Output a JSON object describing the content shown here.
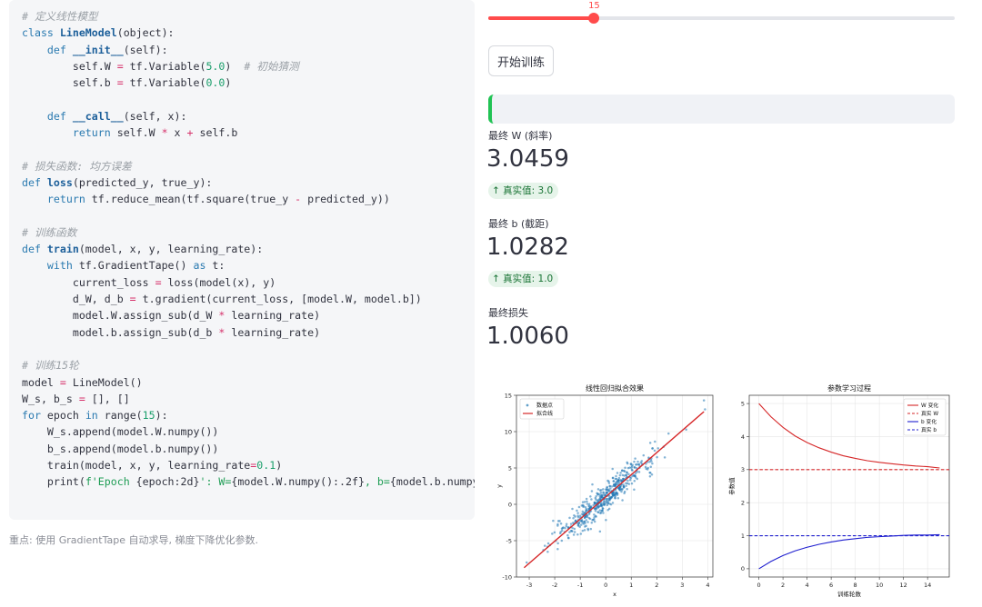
{
  "code": {
    "lines": [
      [
        [
          "cm",
          "# 定义线性模型"
        ]
      ],
      [
        [
          "kw",
          "class "
        ],
        [
          "fn",
          "LineModel"
        ],
        [
          "t",
          "(object):"
        ]
      ],
      [
        [
          "t",
          "    "
        ],
        [
          "kw",
          "def "
        ],
        [
          "fn",
          "__init__"
        ],
        [
          "t",
          "(self):"
        ]
      ],
      [
        [
          "t",
          "        self.W "
        ],
        [
          "op",
          "="
        ],
        [
          "t",
          " tf.Variable("
        ],
        [
          "num",
          "5.0"
        ],
        [
          "t",
          ")  "
        ],
        [
          "cm",
          "# 初始猜测"
        ]
      ],
      [
        [
          "t",
          "        self.b "
        ],
        [
          "op",
          "="
        ],
        [
          "t",
          " tf.Variable("
        ],
        [
          "num",
          "0.0"
        ],
        [
          "t",
          ")"
        ]
      ],
      [],
      [
        [
          "t",
          "    "
        ],
        [
          "kw",
          "def "
        ],
        [
          "fn",
          "__call__"
        ],
        [
          "t",
          "(self, x):"
        ]
      ],
      [
        [
          "t",
          "        "
        ],
        [
          "kw",
          "return"
        ],
        [
          "t",
          " self.W "
        ],
        [
          "op",
          "*"
        ],
        [
          "t",
          " x "
        ],
        [
          "op",
          "+"
        ],
        [
          "t",
          " self.b"
        ]
      ],
      [],
      [
        [
          "cm",
          "# 损失函数: 均方误差"
        ]
      ],
      [
        [
          "kw",
          "def "
        ],
        [
          "fn",
          "loss"
        ],
        [
          "t",
          "(predicted_y, true_y):"
        ]
      ],
      [
        [
          "t",
          "    "
        ],
        [
          "kw",
          "return"
        ],
        [
          "t",
          " tf.reduce_mean(tf.square(true_y "
        ],
        [
          "op",
          "-"
        ],
        [
          "t",
          " predicted_y))"
        ]
      ],
      [],
      [
        [
          "cm",
          "# 训练函数"
        ]
      ],
      [
        [
          "kw",
          "def "
        ],
        [
          "fn",
          "train"
        ],
        [
          "t",
          "(model, x, y, learning_rate):"
        ]
      ],
      [
        [
          "t",
          "    "
        ],
        [
          "kw",
          "with"
        ],
        [
          "t",
          " tf.GradientTape() "
        ],
        [
          "kw",
          "as"
        ],
        [
          "t",
          " t:"
        ]
      ],
      [
        [
          "t",
          "        current_loss "
        ],
        [
          "op",
          "="
        ],
        [
          "t",
          " loss(model(x), y)"
        ]
      ],
      [
        [
          "t",
          "        d_W, d_b "
        ],
        [
          "op",
          "="
        ],
        [
          "t",
          " t.gradient(current_loss, [model.W, model.b])"
        ]
      ],
      [
        [
          "t",
          "        model.W.assign_sub(d_W "
        ],
        [
          "op",
          "*"
        ],
        [
          "t",
          " learning_rate)"
        ]
      ],
      [
        [
          "t",
          "        model.b.assign_sub(d_b "
        ],
        [
          "op",
          "*"
        ],
        [
          "t",
          " learning_rate)"
        ]
      ],
      [],
      [
        [
          "cm",
          "# 训练15轮"
        ]
      ],
      [
        [
          "t",
          "model "
        ],
        [
          "op",
          "="
        ],
        [
          "t",
          " LineModel()"
        ]
      ],
      [
        [
          "t",
          "W_s, b_s "
        ],
        [
          "op",
          "="
        ],
        [
          "t",
          " [], []"
        ]
      ],
      [
        [
          "kw",
          "for"
        ],
        [
          "t",
          " epoch "
        ],
        [
          "kw",
          "in"
        ],
        [
          "t",
          " range("
        ],
        [
          "num",
          "15"
        ],
        [
          "t",
          "):"
        ]
      ],
      [
        [
          "t",
          "    W_s.append(model.W.numpy())"
        ]
      ],
      [
        [
          "t",
          "    b_s.append(model.b.numpy())"
        ]
      ],
      [
        [
          "t",
          "    train(model, x, y, learning_rate"
        ],
        [
          "op",
          "="
        ],
        [
          "num",
          "0.1"
        ],
        [
          "t",
          ")"
        ]
      ],
      [
        [
          "t",
          "    print("
        ],
        [
          "str",
          "f'Epoch "
        ],
        [
          "t",
          "{epoch:2d}"
        ],
        [
          "str",
          "': W="
        ],
        [
          "t",
          "{model.W.numpy():.2f}"
        ],
        [
          "str",
          ", b="
        ],
        [
          "t",
          "{model.b.numpy()"
        ]
      ]
    ]
  },
  "caption": "重点: 使用 GradientTape 自动求导, 梯度下降优化参数.",
  "slider": {
    "value": 15,
    "value_label": "15",
    "fraction": 0.227
  },
  "train_button_label": "开始训练",
  "metrics": [
    {
      "label": "最终 W (斜率)",
      "value": "3.0459",
      "delta": "真实值: 3.0"
    },
    {
      "label": "最终 b (截距)",
      "value": "1.0282",
      "delta": "真实值: 1.0"
    },
    {
      "label": "最终损失",
      "value": "1.0060",
      "delta": ""
    }
  ],
  "delta_arrow": "↑",
  "colors": {
    "accent": "#ff4b4b",
    "success": "#21c354",
    "scatter": "#1f77b4",
    "fit_line": "#d62728",
    "w_line": "#d62728",
    "b_line": "#1f1fcf"
  },
  "chart_data": [
    {
      "type": "scatter",
      "title": "线性回归拟合效果",
      "xlabel": "x",
      "ylabel": "y",
      "xlim": [
        -3.5,
        4.2
      ],
      "ylim": [
        -10,
        15
      ],
      "x_ticks": [
        -3,
        -2,
        -1,
        0,
        1,
        2,
        3,
        4
      ],
      "y_ticks": [
        -10,
        -5,
        0,
        5,
        10,
        15
      ],
      "grid": true,
      "legend": "top-left",
      "series": [
        {
          "name": "数据点",
          "kind": "scatter",
          "n_points": 500,
          "slope": 3.0,
          "intercept": 1.0,
          "noise_sd": 1.0,
          "x_sd": 1.0,
          "outliers": [
            [
              3.85,
              14.3
            ],
            [
              -3.1,
              -8.0
            ]
          ]
        },
        {
          "name": "拟合线",
          "kind": "line",
          "x": [
            -3.2,
            3.85
          ],
          "y": [
            -8.72,
            12.75
          ]
        }
      ]
    },
    {
      "type": "line",
      "title": "参数学习过程",
      "xlabel": "训练轮数",
      "ylabel": "参数值",
      "xlim": [
        -0.8,
        15.8
      ],
      "ylim": [
        -0.25,
        5.25
      ],
      "x_ticks": [
        0,
        2,
        4,
        6,
        8,
        10,
        12,
        14
      ],
      "y_ticks": [
        0,
        1,
        2,
        3,
        4,
        5
      ],
      "grid": true,
      "legend": "top-right",
      "x": [
        0,
        1,
        2,
        3,
        4,
        5,
        6,
        7,
        8,
        9,
        10,
        11,
        12,
        13,
        14,
        15
      ],
      "series": [
        {
          "name": "W 变化",
          "style": "solid",
          "color": "#d62728",
          "values": [
            5.0,
            4.6,
            4.28,
            4.02,
            3.82,
            3.66,
            3.53,
            3.42,
            3.34,
            3.27,
            3.22,
            3.18,
            3.14,
            3.11,
            3.09,
            3.05
          ]
        },
        {
          "name": "真实 W",
          "style": "dashed",
          "color": "#d62728",
          "values": [
            3.0,
            3.0
          ],
          "x": [
            -0.8,
            15.8
          ]
        },
        {
          "name": "b 变化",
          "style": "solid",
          "color": "#1f1fcf",
          "values": [
            0.0,
            0.22,
            0.4,
            0.54,
            0.65,
            0.74,
            0.81,
            0.87,
            0.91,
            0.95,
            0.97,
            0.99,
            1.01,
            1.02,
            1.02,
            1.03
          ]
        },
        {
          "name": "真实 b",
          "style": "dashed",
          "color": "#1f1fcf",
          "values": [
            1.0,
            1.0
          ],
          "x": [
            -0.8,
            15.8
          ]
        }
      ]
    }
  ]
}
